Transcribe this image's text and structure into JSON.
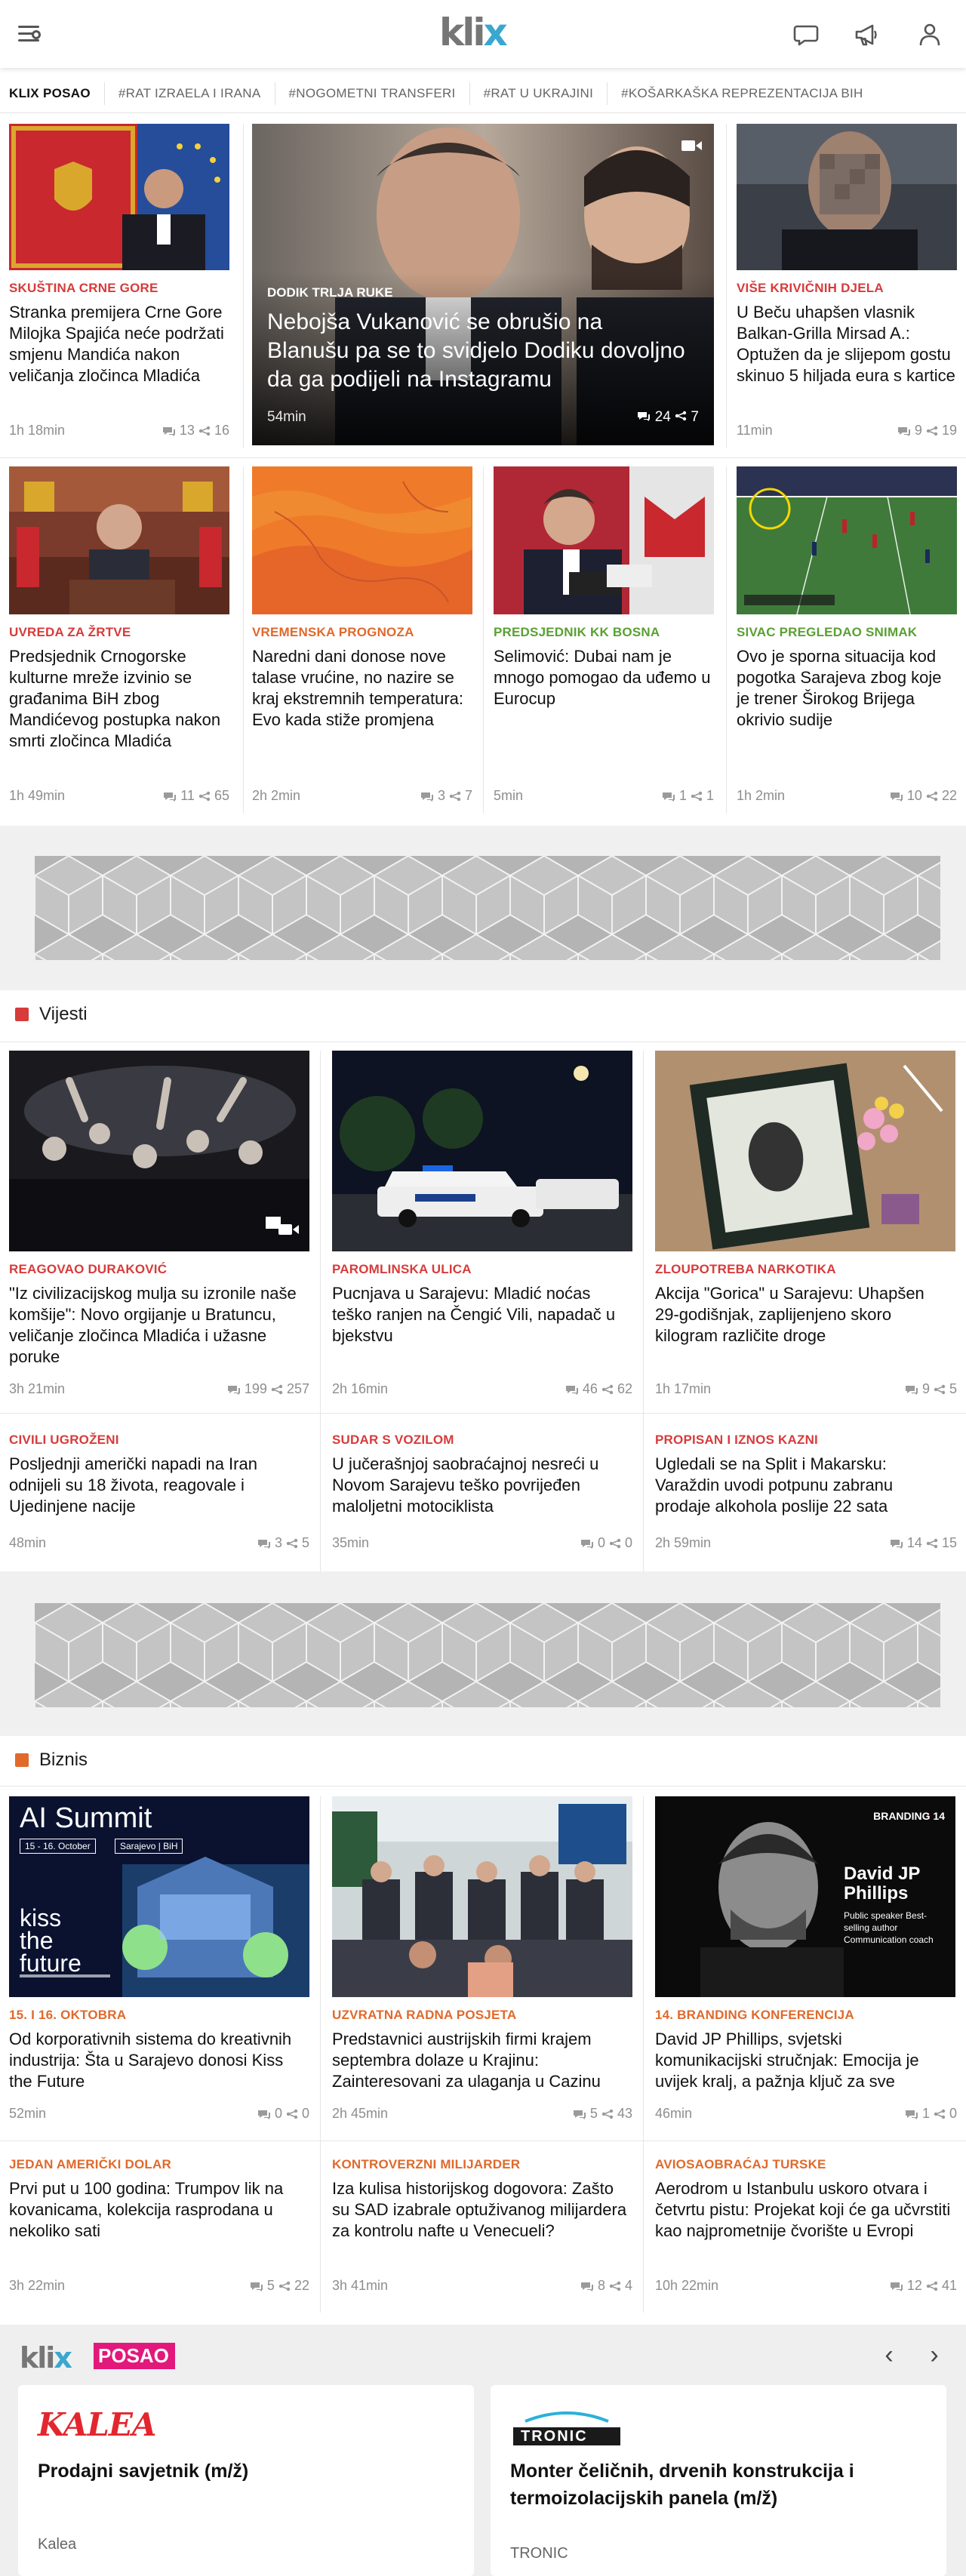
{
  "header": {
    "logo_main": "kli",
    "logo_x": "x",
    "menu_icon": "menu-search-icon",
    "icons": [
      "comments-icon",
      "megaphone-icon",
      "user-icon"
    ]
  },
  "tags": [
    "KLIX POSAO",
    "#RAT IZRAELA I IRANA",
    "#NOGOMETNI TRANSFERI",
    "#RAT U UKRAJINI",
    "#KOŠARKAŠKA REPREZENTACIJA BIH"
  ],
  "top": {
    "left": {
      "kicker": "SKUŠTINA CRNE GORE",
      "title": "Stranka premijera Crne Gore Milojka Spajića neće podržati smjenu Mandića nakon veličanja zločinca Mladića",
      "time": "1h 18min",
      "comments": "13",
      "shares": "16"
    },
    "hero": {
      "kicker": "DODIK TRLJA RUKE",
      "title": "Nebojša Vukanović se obrušio na Blanušu pa se to svidjelo Dodiku dovoljno da ga podijeli na Instagramu",
      "time": "54min",
      "comments": "24",
      "shares": "7"
    },
    "right": {
      "kicker": "VIŠE KRIVIČNIH DJELA",
      "title": "U Beču uhapšen vlasnik Balkan-Grilla Mirsad A.: Optužen da je slijepom gostu skinuo 5 hiljada eura s kartice",
      "time": "11min",
      "comments": "9",
      "shares": "19"
    }
  },
  "row2": [
    {
      "kicker": "UVREDA ZA ŽRTVE",
      "title": "Predsjednik Crnogorske kulturne mreže izvinio se građanima BiH zbog Mandićevog postupka nakon smrti zločinca Mladića",
      "time": "1h 49min",
      "comments": "11",
      "shares": "65"
    },
    {
      "kicker": "VREMENSKA PROGNOZA",
      "title": "Naredni dani donose nove talase vrućine, no nazire se kraj ekstremnih temperatura: Evo kada stiže promjena",
      "time": "2h 2min",
      "comments": "3",
      "shares": "7"
    },
    {
      "kicker": "PREDSJEDNIK KK BOSNA",
      "title": "Selimović: Dubai nam je mnogo pomogao da uđemo u Eurocup",
      "time": "5min",
      "comments": "1",
      "shares": "1"
    },
    {
      "kicker": "SIVAC PREGLEDAO SNIMAK",
      "title": "Ovo je sporna situacija kod pogotka Sarajeva zbog koje je trener Širokog Brijega okrivio sudije",
      "time": "1h 2min",
      "comments": "10",
      "shares": "22"
    }
  ],
  "vijesti": {
    "heading": "Vijesti",
    "items": [
      {
        "kicker": "REAGOVAO DURAKOVIĆ",
        "title": "\"Iz civilizacijskog mulja su izronile naše komšije\": Novo orgijanje u Bratuncu, veličanje zločinca Mladića i užasne poruke",
        "time": "3h 21min",
        "comments": "199",
        "shares": "257"
      },
      {
        "kicker": "PAROMLINSKA ULICA",
        "title": "Pucnjava u Sarajevu: Mladić noćas teško ranjen na Čengić Vili, napadač u bjekstvu",
        "time": "2h 16min",
        "comments": "46",
        "shares": "62"
      },
      {
        "kicker": "ZLOUPOTREBA NARKOTIKA",
        "title": "Akcija \"Gorica\" u Sarajevu: Uhapšen 29-godišnjak, zaplijenjeno skoro kilogram različite droge",
        "time": "1h 17min",
        "comments": "9",
        "shares": "5"
      },
      {
        "kicker": "CIVILI UGROŽENI",
        "title": "Posljednji američki napadi na Iran odnijeli su 18 života, reagovale i Ujedinjene nacije",
        "time": "48min",
        "comments": "3",
        "shares": "5"
      },
      {
        "kicker": "SUDAR S VOZILOM",
        "title": "U jučerašnjoj saobraćajnoj nesreći u Novom Sarajevu teško povrijeđen maloljetni motociklista",
        "time": "35min",
        "comments": "0",
        "shares": "0"
      },
      {
        "kicker": "PROPISAN I IZNOS KAZNI",
        "title": "Ugledali se na Split i Makarsku: Varaždin uvodi potpunu zabranu prodaje alkohola poslije 22 sata",
        "time": "2h 59min",
        "comments": "14",
        "shares": "15"
      }
    ]
  },
  "biznis": {
    "heading": "Biznis",
    "ai_summit": {
      "title": "AI Summit",
      "date": "15 - 16. October",
      "place": "Sarajevo | BiH",
      "kiss": "kiss the future"
    },
    "branding": {
      "badge": "BRANDING 14",
      "name": "David JP Phillips",
      "sub": "Public speaker Best-selling author Communication coach"
    },
    "items": [
      {
        "kicker": "15. I 16. OKTOBRA",
        "title": "Od korporativnih sistema do kreativnih industrija: Šta u Sarajevo donosi Kiss the Future",
        "time": "52min",
        "comments": "0",
        "shares": "0"
      },
      {
        "kicker": "UZVRATNA RADNA POSJETA",
        "title": "Predstavnici austrijskih firmi krajem septembra dolaze u Krajinu: Zainteresovani za ulaganja u Cazinu",
        "time": "2h 45min",
        "comments": "5",
        "shares": "43"
      },
      {
        "kicker": "14. BRANDING KONFERENCIJA",
        "title": "David JP Phillips, svjetski komunikacijski stručnjak: Emocija je uvijek kralj, a pažnja ključ za sve",
        "time": "46min",
        "comments": "1",
        "shares": "0"
      },
      {
        "kicker": "JEDAN AMERIČKI DOLAR",
        "title": "Prvi put u 100 godina: Trumpov lik na kovanicama, kolekcija rasprodana u nekoliko sati",
        "time": "3h 22min",
        "comments": "5",
        "shares": "22"
      },
      {
        "kicker": "KONTROVERZNI MILIJARDER",
        "title": "Iza kulisa historijskog dogovora: Zašto su SAD izabrale optuživanog milijardera za kontrolu nafte u Venecueli?",
        "time": "3h 41min",
        "comments": "8",
        "shares": "4"
      },
      {
        "kicker": "AVIOSAOBRAĆAJ TURSKE",
        "title": "Aerodrom u Istanbulu uskoro otvara i četvrtu pistu: Projekat koji će ga učvrstiti kao najprometnije čvorište u Evropi",
        "time": "10h 22min",
        "comments": "12",
        "shares": "41"
      }
    ]
  },
  "posao": {
    "logo_main": "kli",
    "logo_x": "x",
    "tag": "POSAO",
    "prev": "‹",
    "next": "›",
    "jobs": [
      {
        "company_logo": "KALEA",
        "title": "Prodajni savjetnik (m/ž)",
        "company": "Kalea"
      },
      {
        "company_logo": "TRONIC",
        "title": "Monter čeličnih, drvenih konstrukcija i termoizolacijskih panela (m/ž)",
        "company": "TRONIC"
      }
    ]
  },
  "colors": {
    "red": "#d73b3b",
    "orange": "#e0692b",
    "green": "#5aa033",
    "blue": "#3aa7cf",
    "posao": "#e2187c"
  }
}
